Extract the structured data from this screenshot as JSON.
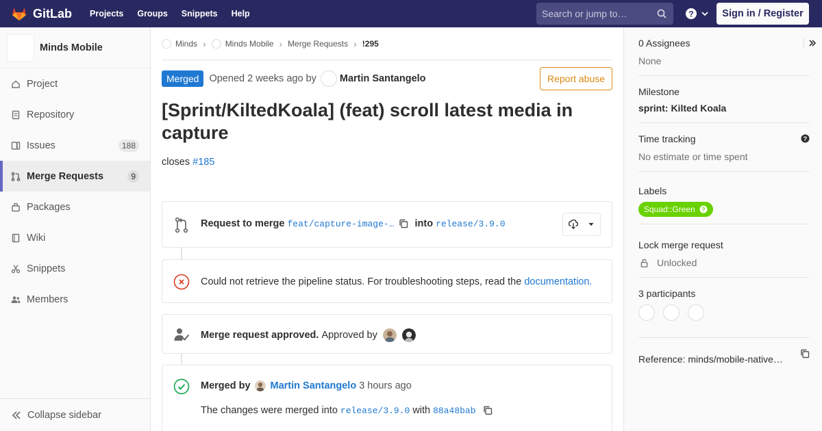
{
  "navbar": {
    "brand": "GitLab",
    "links": [
      "Projects",
      "Groups",
      "Snippets",
      "Help"
    ],
    "search_placeholder": "Search or jump to…",
    "signin": "Sign in / Register"
  },
  "sidebar": {
    "project_name": "Minds Mobile",
    "items": [
      {
        "label": "Project",
        "icon": "home-icon"
      },
      {
        "label": "Repository",
        "icon": "doc-icon"
      },
      {
        "label": "Issues",
        "icon": "issues-icon",
        "badge": "188"
      },
      {
        "label": "Merge Requests",
        "icon": "merge-request-icon",
        "badge": "9",
        "active": true
      },
      {
        "label": "Packages",
        "icon": "package-icon"
      },
      {
        "label": "Wiki",
        "icon": "book-icon"
      },
      {
        "label": "Snippets",
        "icon": "scissors-icon"
      },
      {
        "label": "Members",
        "icon": "users-icon"
      }
    ],
    "collapse": "Collapse sidebar"
  },
  "breadcrumb": [
    "Minds",
    "Minds Mobile",
    "Merge Requests",
    "!295"
  ],
  "mr": {
    "status": "Merged",
    "opened_text": "Opened 2 weeks ago by",
    "author": "Martin Santangelo",
    "report": "Report abuse",
    "title": "[Sprint/KiltedKoala] (feat) scroll latest media in capture",
    "desc_prefix": "closes",
    "desc_link": "#185"
  },
  "widgets": {
    "request": {
      "label": "Request to merge",
      "source_branch": "feat/capture-image-…",
      "into": "into",
      "target_branch": "release/3.9.0"
    },
    "pipeline": {
      "text": "Could not retrieve the pipeline status. For troubleshooting steps, read the",
      "link": "documentation."
    },
    "approval": {
      "bold": "Merge request approved.",
      "text": "Approved by"
    },
    "merged": {
      "label": "Merged by",
      "user": "Martin Santangelo",
      "time": "3 hours ago",
      "changes_text": "The changes were merged into",
      "branch": "release/3.9.0",
      "with": "with",
      "commit": "88a48bab"
    }
  },
  "right_sidebar": {
    "assignees_title": "0 Assignees",
    "assignees_value": "None",
    "milestone_title": "Milestone",
    "milestone_value": "sprint: Kilted Koala",
    "time_title": "Time tracking",
    "time_value": "No estimate or time spent",
    "labels_title": "Labels",
    "label_pill": "Squad::Green",
    "label_color": "#69d100",
    "lock_title": "Lock merge request",
    "lock_value": "Unlocked",
    "participants_title": "3 participants",
    "reference": "Reference: minds/mobile-native…"
  },
  "colors": {
    "navbar": "#292961",
    "merged_badge": "#1f78d1",
    "link": "#1f78d1",
    "report_abuse": "#db8a12",
    "sidebar_active": "#6666c4"
  }
}
